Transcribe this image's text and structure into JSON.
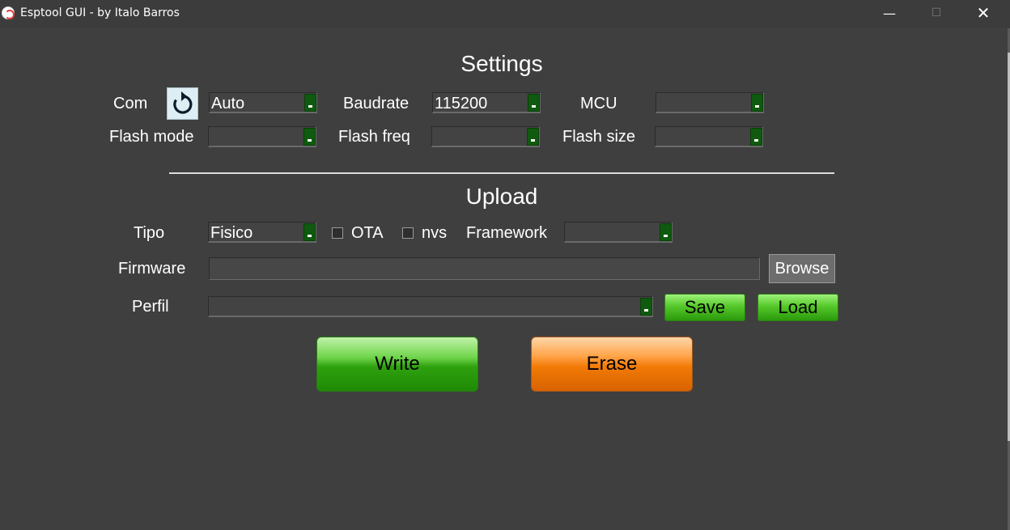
{
  "window": {
    "title": "Esptool GUI - by Italo Barros",
    "minimize_glyph": "—",
    "maximize_glyph": "☐",
    "close_glyph": "✕"
  },
  "settings": {
    "heading": "Settings",
    "com": {
      "label": "Com",
      "value": "Auto"
    },
    "baudrate": {
      "label": "Baudrate",
      "value": "115200"
    },
    "mcu": {
      "label": "MCU",
      "value": ""
    },
    "flash_mode": {
      "label": "Flash mode",
      "value": ""
    },
    "flash_freq": {
      "label": "Flash freq",
      "value": ""
    },
    "flash_size": {
      "label": "Flash size",
      "value": ""
    },
    "refresh_icon": "refresh-icon"
  },
  "upload": {
    "heading": "Upload",
    "tipo": {
      "label": "Tipo",
      "value": "Fisico"
    },
    "ota": {
      "label": "OTA",
      "checked": false
    },
    "nvs": {
      "label": "nvs",
      "checked": false
    },
    "framework": {
      "label": "Framework",
      "value": ""
    },
    "firmware": {
      "label": "Firmware",
      "value": "",
      "browse_label": "Browse"
    },
    "perfil": {
      "label": "Perfil",
      "value": "",
      "save_label": "Save",
      "load_label": "Load"
    },
    "write_label": "Write",
    "erase_label": "Erase"
  },
  "colors": {
    "background": "#3f3f3f",
    "dropdown_arrow": "#0f5a0f",
    "write_button": "#2ea10e",
    "erase_button": "#f27a06"
  }
}
